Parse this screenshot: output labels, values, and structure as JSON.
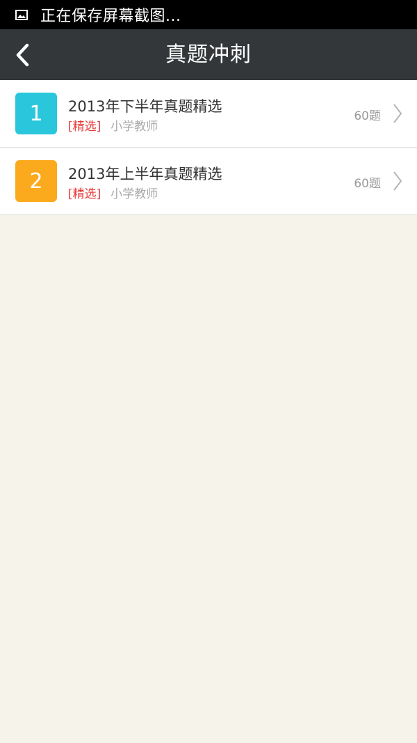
{
  "status_bar": {
    "text": "正在保存屏幕截图...",
    "icon": "image-icon"
  },
  "header": {
    "title": "真题冲刺",
    "back_icon": "back-arrow-icon"
  },
  "list": {
    "items": [
      {
        "number": "1",
        "title": "2013年下半年真题精选",
        "tag": "[精选]",
        "category": "小学教师",
        "count": "60题",
        "badge_color": "#2ac7dc"
      },
      {
        "number": "2",
        "title": "2013年上半年真题精选",
        "tag": "[精选]",
        "category": "小学教师",
        "count": "60题",
        "badge_color": "#fcaa1d"
      }
    ]
  },
  "colors": {
    "status_bar_bg": "#000000",
    "app_bar_bg": "#333739",
    "page_bg": "#f6f3ea",
    "tag_red": "#e53935"
  }
}
